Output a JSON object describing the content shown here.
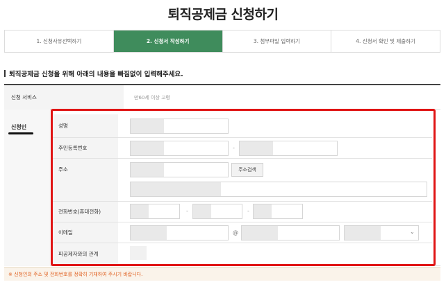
{
  "page_title": "퇴직공제금 신청하기",
  "steps": [
    {
      "label": "1. 신청사유선택하기",
      "active": false
    },
    {
      "label": "2. 신청서 작성하기",
      "active": true
    },
    {
      "label": "3. 첨부파일 입력하기",
      "active": false
    },
    {
      "label": "4. 신청서 확인 및 제출하기",
      "active": false
    }
  ],
  "notice": "퇴직공제금 신청을 위해 아래의 내용을 빠짐없이 입력해주세요.",
  "service": {
    "label": "신청 서비스",
    "value": "만60세 이상 고령"
  },
  "applicant": {
    "section_label": "신청인",
    "name_label": "성명",
    "rrn_label": "주민등록번호",
    "address_label": "주소",
    "address_search_button": "주소검색",
    "phone_label": "전화번호(휴대전화)",
    "email_label": "이메일",
    "email_at": "@",
    "relation_label": "피공제자와의 관계",
    "dash": "-"
  },
  "footnote": "※ 신청인의 주소 및 전화번호를 정확히 기재하여 주시기 바랍니다.",
  "colors": {
    "active_step": "#3f8c5c",
    "highlight": "#e01414",
    "footnote_text": "#e06020"
  }
}
